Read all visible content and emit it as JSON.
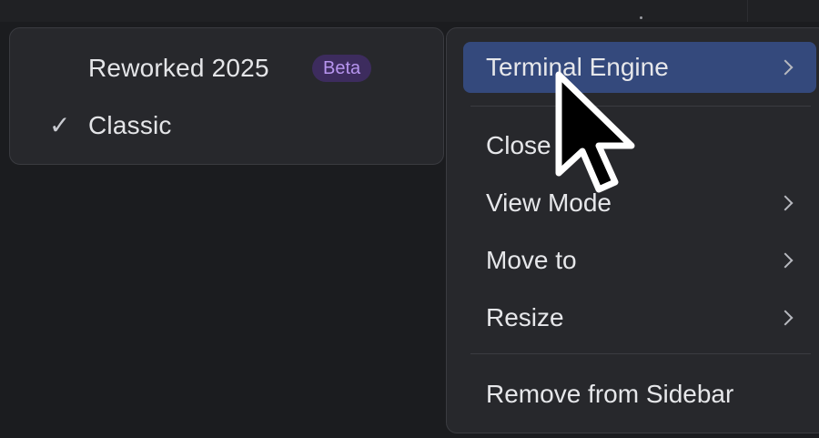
{
  "submenu": {
    "items": [
      {
        "label": "Reworked 2025",
        "badge": "Beta",
        "checked": false
      },
      {
        "label": "Classic",
        "check_glyph": "✓",
        "checked": true
      }
    ]
  },
  "menu": {
    "items": [
      {
        "label": "Terminal Engine",
        "has_submenu": true,
        "highlighted": true
      },
      {
        "label": "Close",
        "has_submenu": false
      },
      {
        "label": "View Mode",
        "has_submenu": true
      },
      {
        "label": "Move to",
        "has_submenu": true
      },
      {
        "label": "Resize",
        "has_submenu": true
      },
      {
        "label": "Remove from Sidebar",
        "has_submenu": false
      }
    ]
  },
  "colors": {
    "highlight": "#34497c",
    "badge_bg": "#3d2c5e",
    "badge_text": "#b795ef",
    "menu_bg": "#27282c"
  },
  "icons": [
    "check-icon",
    "chevron-right-icon",
    "mouse-cursor-icon"
  ]
}
